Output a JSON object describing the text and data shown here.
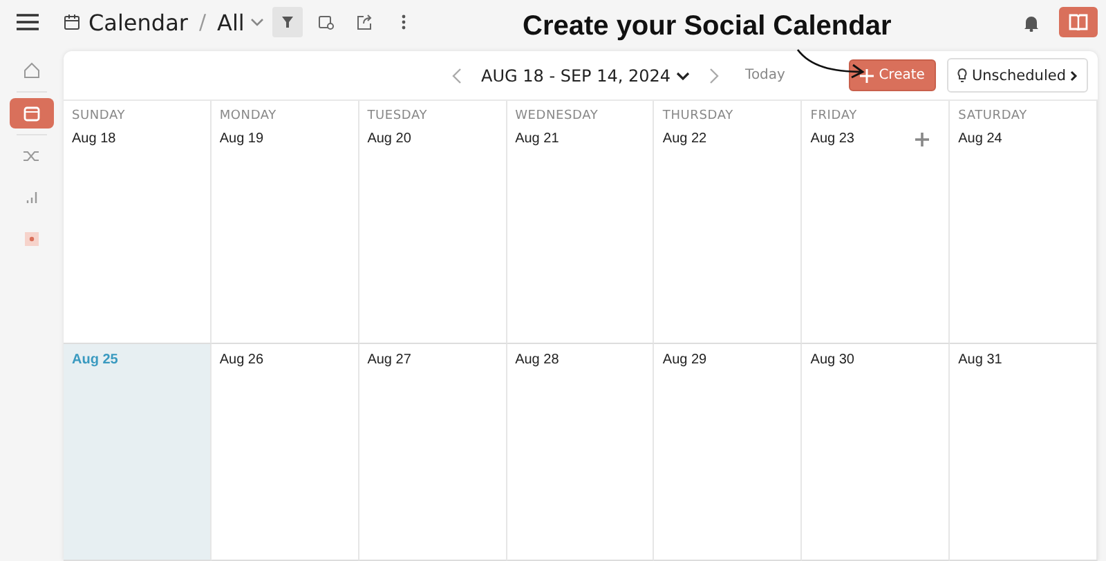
{
  "header": {
    "title": "Calendar",
    "separator": "/",
    "view": "All",
    "filter_active": true
  },
  "annotation": {
    "text": "Create your Social Calendar"
  },
  "sidebar": {
    "items": [
      {
        "kind": "home",
        "selected": false
      },
      {
        "kind": "calendar",
        "selected": true
      },
      {
        "kind": "shuffle",
        "selected": false
      },
      {
        "kind": "chart",
        "selected": false
      },
      {
        "kind": "tag",
        "selected": false
      }
    ]
  },
  "toolbar": {
    "range": "AUG 18 - SEP 14, 2024",
    "today": "Today",
    "create": "Create",
    "unscheduled": "Unscheduled"
  },
  "weekdays": [
    "SUNDAY",
    "MONDAY",
    "TUESDAY",
    "WEDNESDAY",
    "THURSDAY",
    "FRIDAY",
    "SATURDAY"
  ],
  "weeks": [
    [
      {
        "date": "Aug 18",
        "today": false,
        "add": false
      },
      {
        "date": "Aug 19",
        "today": false,
        "add": false
      },
      {
        "date": "Aug 20",
        "today": false,
        "add": false
      },
      {
        "date": "Aug 21",
        "today": false,
        "add": false
      },
      {
        "date": "Aug 22",
        "today": false,
        "add": false
      },
      {
        "date": "Aug 23",
        "today": false,
        "add": true
      },
      {
        "date": "Aug 24",
        "today": false,
        "add": false
      }
    ],
    [
      {
        "date": "Aug 25",
        "today": true,
        "add": false
      },
      {
        "date": "Aug 26",
        "today": false,
        "add": false
      },
      {
        "date": "Aug 27",
        "today": false,
        "add": false
      },
      {
        "date": "Aug 28",
        "today": false,
        "add": false
      },
      {
        "date": "Aug 29",
        "today": false,
        "add": false
      },
      {
        "date": "Aug 30",
        "today": false,
        "add": false
      },
      {
        "date": "Aug 31",
        "today": false,
        "add": false
      }
    ]
  ]
}
